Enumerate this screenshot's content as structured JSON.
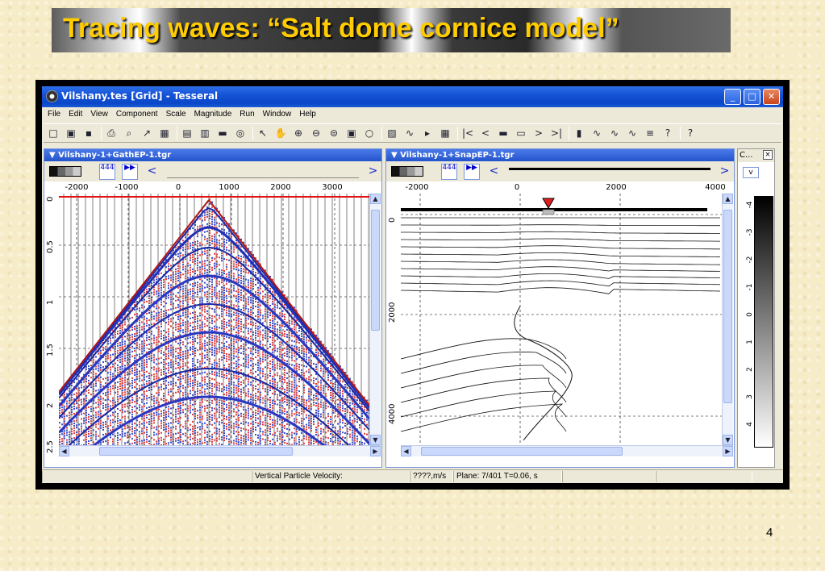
{
  "slide": {
    "title": "Tracing waves: “Salt dome cornice model”",
    "page_number": "4"
  },
  "window": {
    "title": "Vilshany.tes [Grid] - Tesseral",
    "minimize_label": "_",
    "maximize_label": "□",
    "close_label": "✕"
  },
  "menu": [
    "File",
    "Edit",
    "View",
    "Component",
    "Scale",
    "Magnitude",
    "Run",
    "Window",
    "Help"
  ],
  "toolbar_icons": [
    "new-file-icon",
    "open-folder-icon",
    "save-icon",
    "print-icon",
    "print-preview-icon",
    "wand-icon",
    "grid-icon",
    "table-icon",
    "layers-icon",
    "device-icon",
    "zoom-target-icon",
    "pointer-icon",
    "hand-icon",
    "zoom-in-icon",
    "zoom-out-icon",
    "zoom-fit-icon",
    "zoom-extent-icon",
    "lock-icon",
    "properties-icon",
    "curve-icon",
    "marker-icon",
    "snapshot-icon",
    "first-frame-icon",
    "prev-frame-icon",
    "movie-icon",
    "camera-icon",
    "next-frame-icon",
    "last-frame-icon",
    "chart-icon",
    "ray-icon",
    "ray-trace-icon",
    "ray-fan-icon",
    "ray-settings-icon",
    "help-icon",
    "context-help-icon"
  ],
  "toolbar_glyphs": [
    "□",
    "▣",
    "▪",
    "⎙",
    "⌕",
    "↗",
    "▦",
    "▤",
    "▥",
    "▬",
    "◎",
    "↖",
    "✋",
    "⊕",
    "⊖",
    "⊜",
    "▣",
    "○",
    "▨",
    "∿",
    "▸",
    "▦",
    "|<",
    "<",
    "▬",
    "▭",
    ">",
    ">|",
    "▮",
    "∿",
    "∿",
    "∿",
    "≡",
    "?",
    "?"
  ],
  "left_panel": {
    "title": "Vilshany-1+GathEP-1.tgr",
    "x_ticks": [
      "-2000",
      "-1000",
      "0",
      "1000",
      "2000",
      "3000"
    ],
    "y_ticks": [
      "0",
      "0.5",
      "1",
      "1.5",
      "2",
      "2.5"
    ],
    "prev_frame_label": "444",
    "next_frame_label": "▶▶"
  },
  "right_panel": {
    "title": "Vilshany-1+SnapEP-1.tgr",
    "x_ticks": [
      "-2000",
      "0",
      "2000",
      "4000"
    ],
    "y_ticks": [
      "0",
      "2000",
      "4000"
    ],
    "prev_frame_label": "444",
    "next_frame_label": "▶▶"
  },
  "colorbar": {
    "title": "C...",
    "close_label": "×",
    "dropdown_label": "v",
    "ticks": [
      "-4",
      "-3",
      "-2",
      "-1",
      "0",
      "1",
      "2",
      "3",
      "4"
    ]
  },
  "statusbar": {
    "field_label": "Vertical Particle Velocity:",
    "value": "????,m/s",
    "plane": "Plane: 7/401 T=0.06, s"
  }
}
